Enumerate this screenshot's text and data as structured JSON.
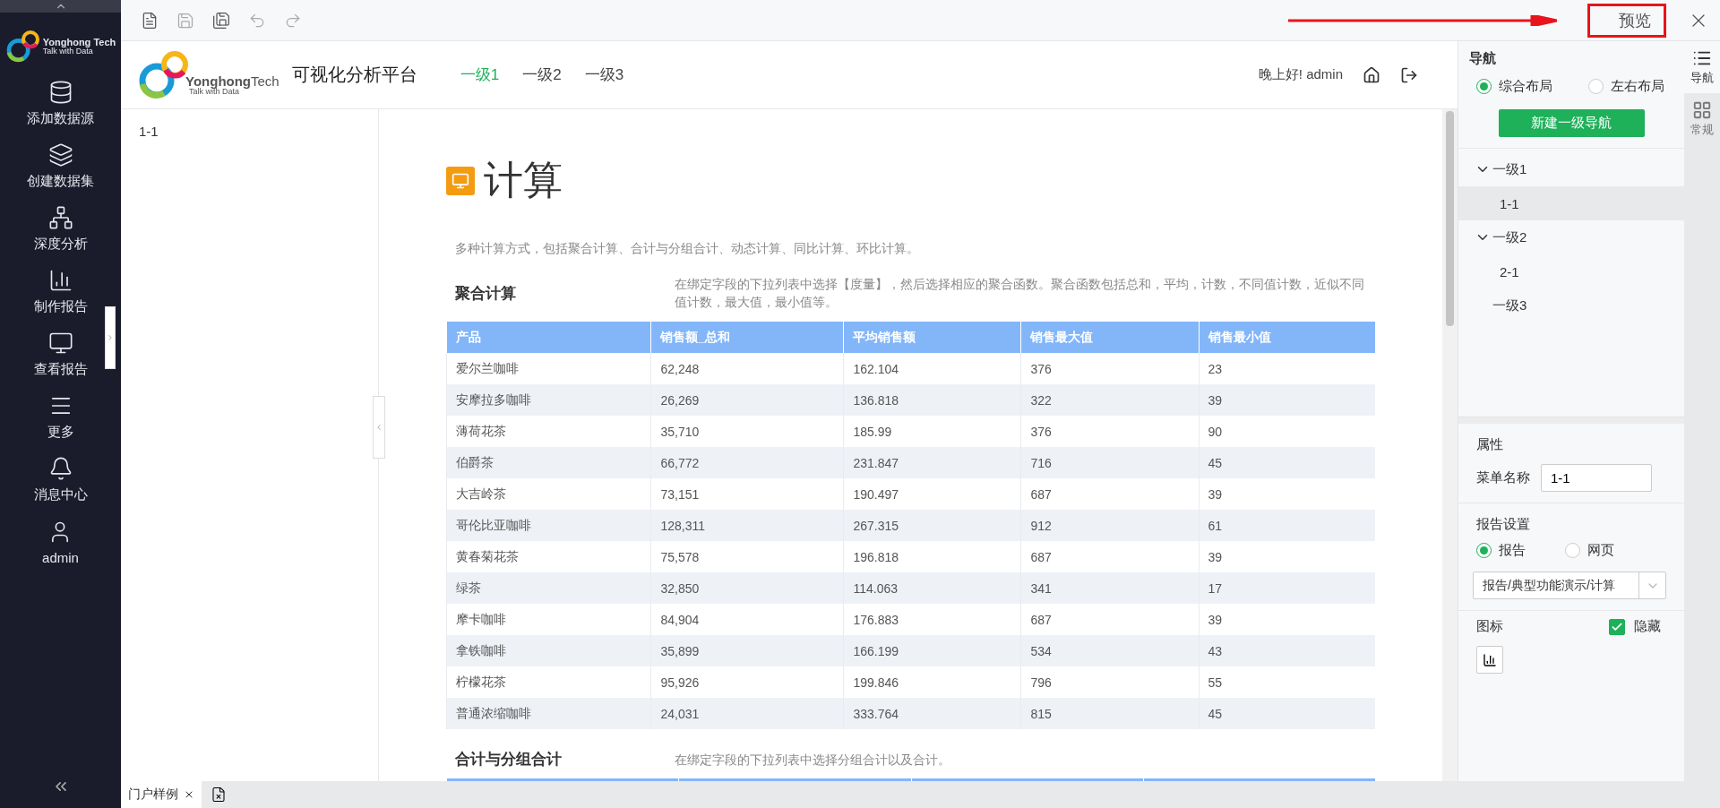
{
  "sidebar": {
    "logo": {
      "name": "Yonghong Tech",
      "tagline": "Talk with Data"
    },
    "items": [
      {
        "label": "添加数据源"
      },
      {
        "label": "创建数据集"
      },
      {
        "label": "深度分析"
      },
      {
        "label": "制作报告"
      },
      {
        "label": "查看报告"
      },
      {
        "label": "更多"
      },
      {
        "label": "消息中心"
      },
      {
        "label": "admin"
      }
    ]
  },
  "toolbar": {
    "preview_button": {
      "label": "预览",
      "highlighted": true
    }
  },
  "preview": {
    "logo": {
      "name": "Yonghong",
      "name_suffix": "Tech",
      "tagline": "Talk with Data"
    },
    "title": "可视化分析平台",
    "nav": [
      {
        "label": "一级1",
        "selected": true
      },
      {
        "label": "一级2",
        "selected": false
      },
      {
        "label": "一级3",
        "selected": false
      }
    ],
    "greeting": "晚上好! admin",
    "left_nav": [
      {
        "label": "1-1"
      }
    ],
    "page_title": "计算",
    "intro": "多种计算方式，包括聚合计算、合计与分组合计、动态计算、同比计算、环比计算。",
    "sections": [
      {
        "title": "聚合计算",
        "description": "在绑定字段的下拉列表中选择【度量】，然后选择相应的聚合函数。聚合函数包括总和，平均，计数，不同值计数，近似不同值计数，最大值，最小值等。",
        "table": {
          "columns": [
            "产品",
            "销售额_总和",
            "平均销售额",
            "销售最大值",
            "销售最小值"
          ],
          "rows": [
            [
              "爱尔兰咖啡",
              "62,248",
              "162.104",
              "376",
              "23"
            ],
            [
              "安摩拉多咖啡",
              "26,269",
              "136.818",
              "322",
              "39"
            ],
            [
              "薄荷花茶",
              "35,710",
              "185.99",
              "376",
              "90"
            ],
            [
              "伯爵茶",
              "66,772",
              "231.847",
              "716",
              "45"
            ],
            [
              "大吉岭茶",
              "73,151",
              "190.497",
              "687",
              "39"
            ],
            [
              "哥伦比亚咖啡",
              "128,311",
              "267.315",
              "912",
              "61"
            ],
            [
              "黄春菊花茶",
              "75,578",
              "196.818",
              "687",
              "39"
            ],
            [
              "绿茶",
              "32,850",
              "114.063",
              "341",
              "17"
            ],
            [
              "摩卡咖啡",
              "84,904",
              "176.883",
              "687",
              "39"
            ],
            [
              "拿铁咖啡",
              "35,899",
              "166.199",
              "534",
              "43"
            ],
            [
              "柠檬花茶",
              "95,926",
              "199.846",
              "796",
              "55"
            ],
            [
              "普通浓缩咖啡",
              "24,031",
              "333.764",
              "815",
              "45"
            ]
          ]
        }
      },
      {
        "title": "合计与分组合计",
        "description": "在绑定字段的下拉列表中选择分组合计以及合计。"
      }
    ]
  },
  "right_panel": {
    "title": "导航",
    "layouts": [
      {
        "label": "综合布局",
        "selected": true
      },
      {
        "label": "左右布局",
        "selected": false
      }
    ],
    "new_button": "新建一级导航",
    "tree": [
      {
        "label": "一级1",
        "expanded": true,
        "selected": false,
        "children": [
          {
            "label": "1-1",
            "selected": true
          }
        ]
      },
      {
        "label": "一级2",
        "expanded": true,
        "selected": false,
        "children": [
          {
            "label": "2-1",
            "selected": false
          }
        ]
      },
      {
        "label": "一级3",
        "selected": false
      }
    ],
    "properties": {
      "title": "属性",
      "field_label": "菜单名称",
      "field_value": "1-1"
    },
    "report_settings": {
      "title": "报告设置",
      "options": [
        {
          "label": "报告",
          "selected": true
        },
        {
          "label": "网页",
          "selected": false
        }
      ],
      "path": "报告/典型功能演示/计算"
    },
    "icon_setting": {
      "label": "图标",
      "hide": {
        "label": "隐藏",
        "checked": true
      }
    }
  },
  "side_tabs": [
    {
      "label": "导航",
      "selected": true
    },
    {
      "label": "常规",
      "selected": false
    }
  ],
  "bottom_tabs": [
    {
      "label": "门户样例",
      "selected": true
    }
  ]
}
